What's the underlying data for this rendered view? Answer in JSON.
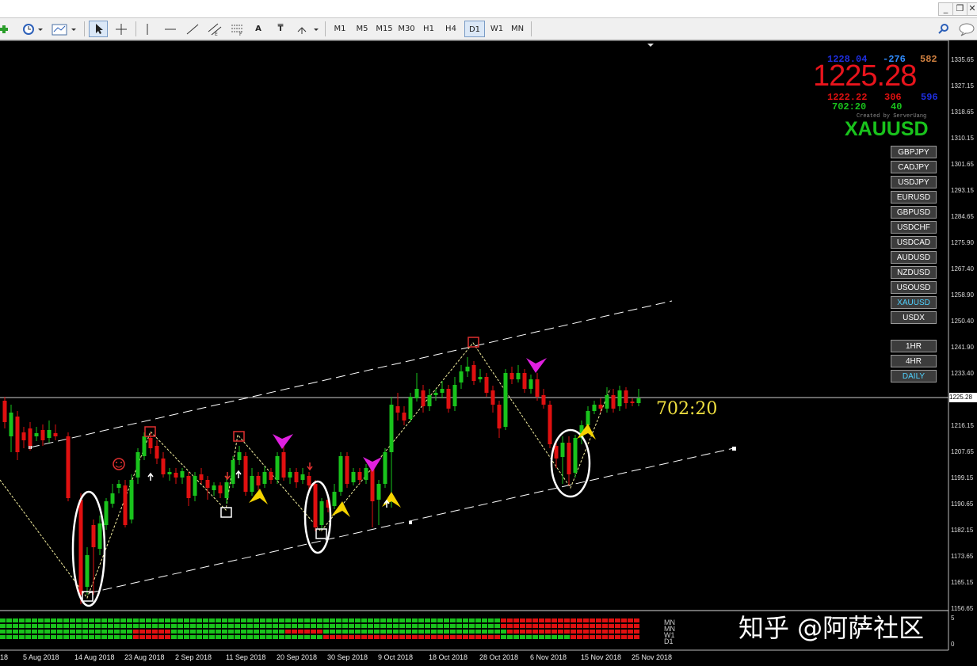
{
  "window": {
    "minimize": "_",
    "restore": "❐",
    "close": "✕"
  },
  "toolbar": {
    "timeframes": [
      "M1",
      "M5",
      "M15",
      "M30",
      "H1",
      "H4",
      "D1",
      "W1",
      "MN"
    ],
    "active_timeframe": "D1",
    "tools": [
      "add-icon",
      "clock-icon",
      "chart-icon",
      "cursor-icon",
      "crosshair-icon",
      "vertical-line-icon",
      "horizontal-line-icon",
      "trendline-icon",
      "equidistant-channel-icon",
      "fibonacci-icon",
      "text-icon",
      "text-label-icon",
      "arrows-icon"
    ],
    "text_tool_glyph": "A",
    "label_tool_glyph": "T",
    "search_glyph": "🔍",
    "chat_glyph": "💬"
  },
  "info_panel": {
    "bid_high": "1228.04",
    "change1": "-276",
    "count1": "582",
    "price": "1225.28",
    "bid_low": "1222.22",
    "change2": "306",
    "count2": "596",
    "timer": "702:20",
    "count3": "40",
    "created_by": "Created by ServerUang",
    "symbol": "XAUUSD"
  },
  "symbols": [
    "GBPJPY",
    "CADJPY",
    "USDJPY",
    "EURUSD",
    "GBPUSD",
    "USDCHF",
    "USDCAD",
    "AUDUSD",
    "NZDUSD",
    "USOUSD",
    "XAUUSD",
    "USDX"
  ],
  "active_symbol": "XAUUSD",
  "periods": [
    "1HR",
    "4HR",
    "DAILY"
  ],
  "active_period": "DAILY",
  "countdown_label": "702:20",
  "price_axis": [
    "1335.65",
    "1327.15",
    "1318.65",
    "1310.15",
    "1301.65",
    "1293.15",
    "1284.65",
    "1275.90",
    "1267.40",
    "1258.90",
    "1250.40",
    "1241.90",
    "1233.40",
    "1225.28",
    "1216.15",
    "1207.65",
    "1199.15",
    "1190.65",
    "1182.15",
    "1173.65",
    "1165.15",
    "1156.65"
  ],
  "current_price_label": "1225.28",
  "date_axis": [
    "18",
    "5 Aug 2018",
    "14 Aug 2018",
    "23 Aug 2018",
    "2 Sep 2018",
    "11 Sep 2018",
    "20 Sep 2018",
    "30 Sep 2018",
    "9 Oct 2018",
    "18 Oct 2018",
    "28 Oct 2018",
    "6 Nov 2018",
    "15 Nov 2018",
    "25 Nov 2018"
  ],
  "heatmap_rows": [
    "MN",
    "MN",
    "W1",
    "D1"
  ],
  "heatmap_scale_top": "5",
  "heatmap_scale_bottom": "0",
  "watermark": "知乎 @阿萨社区",
  "colors": {
    "bull": "#19c31c",
    "bear": "#e01010",
    "price_big": "#e8141c",
    "symbol": "#19c31c"
  }
}
